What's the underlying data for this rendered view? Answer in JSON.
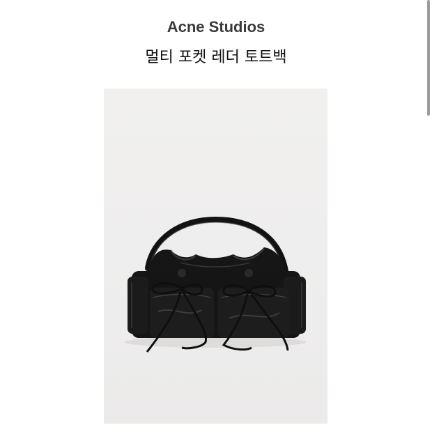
{
  "product": {
    "brand": "Acne Studios",
    "title": "멀티 포켓 레더 토트백"
  },
  "colors": {
    "image_background": "#efeeed",
    "leather": "#141414",
    "highlight": "#3a3a3a"
  }
}
